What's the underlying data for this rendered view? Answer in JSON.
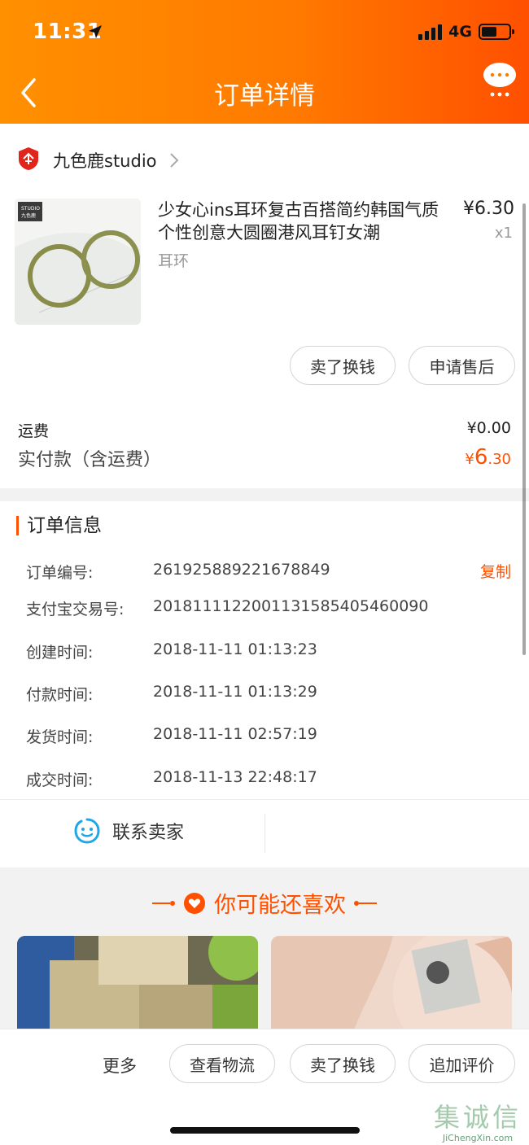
{
  "status_bar": {
    "time": "11:31",
    "network": "4G"
  },
  "header": {
    "title": "订单详情"
  },
  "seller": {
    "name": "九色鹿studio"
  },
  "product": {
    "title": "少女心ins耳环复古百搭简约韩国气质个性创意大圆圈港风耳钉女潮",
    "spec": "耳环",
    "price": "¥6.30",
    "quantity": "x1",
    "image_brand_text": "STUDIO\n九色鹿"
  },
  "item_actions": {
    "sell": "卖了换钱",
    "after_sale": "申请售后"
  },
  "fees": {
    "shipping_label": "运费",
    "shipping_value": "¥0.00",
    "total_label": "实付款（含运费）",
    "total_currency": "¥",
    "total_int": "6",
    "total_dec": ".30"
  },
  "order_info": {
    "title": "订单信息",
    "copy_label": "复制",
    "rows": [
      {
        "label": "订单编号:",
        "value": "261925889221678849"
      },
      {
        "label": "支付宝交易号:",
        "value": "2018111122001131585405460090"
      },
      {
        "label": "创建时间:",
        "value": "2018-11-11 01:13:23"
      },
      {
        "label": "付款时间:",
        "value": "2018-11-11 01:13:29"
      },
      {
        "label": "发货时间:",
        "value": "2018-11-11 02:57:19"
      },
      {
        "label": "成交时间:",
        "value": "2018-11-13 22:48:17"
      }
    ]
  },
  "contact": {
    "label": "联系卖家"
  },
  "recommend": {
    "title": "你可能还喜欢"
  },
  "bottom_bar": {
    "more": "更多",
    "logistics": "查看物流",
    "sell": "卖了换钱",
    "review": "追加评价"
  },
  "watermark": {
    "text": "集诚信",
    "domain": "JiChengXin.com"
  },
  "colors": {
    "accent": "#ff5000",
    "header_start": "#ff9000",
    "header_end": "#ff5000"
  },
  "icons": [
    "location-arrow-icon",
    "signal-icon",
    "battery-icon",
    "back-icon",
    "chat-bubble-icon",
    "shop-badge-icon",
    "chevron-right-icon",
    "smile-chat-icon",
    "heart-icon"
  ]
}
